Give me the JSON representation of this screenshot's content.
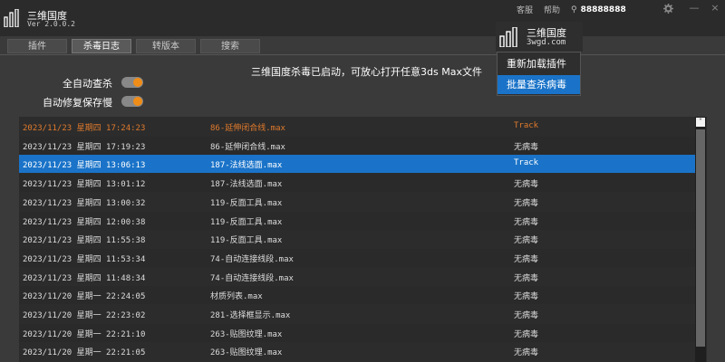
{
  "app": {
    "name": "三维国度",
    "version": "Ver 2.0.0.2"
  },
  "header": {
    "links": [
      "客服",
      "帮助"
    ],
    "username": "88888888",
    "user_icon": "user-icon",
    "settings_icon": "gear-icon",
    "minimize_label": "—",
    "close_label": "×"
  },
  "tabs": [
    {
      "label": "插件",
      "active": false
    },
    {
      "label": "杀毒日志",
      "active": true
    },
    {
      "label": "转版本",
      "active": false
    },
    {
      "label": "搜索",
      "active": false
    }
  ],
  "toggles": [
    {
      "label": "全自动查杀",
      "on": true
    },
    {
      "label": "自动修复保存慢",
      "on": true
    }
  ],
  "notice": "三维国度杀毒已启动，可放心打开任意3ds Max文件",
  "popup": {
    "brand_name": "三维国度",
    "brand_url": "3wgd.com",
    "menu_items": [
      {
        "label": "重新加载插件",
        "active": false
      },
      {
        "label": "批量查杀病毒",
        "active": true
      }
    ]
  },
  "log": {
    "rows": [
      {
        "time": "2023/11/23 星期四 17:24:23",
        "file": "86-延伸闭合线.max",
        "status": "Track",
        "kind": "threat"
      },
      {
        "time": "2023/11/23 星期四 17:19:23",
        "file": "86-延伸闭合线.max",
        "status": "无病毒",
        "kind": "normal"
      },
      {
        "time": "2023/11/23 星期四 13:06:13",
        "file": "187-法线选面.max",
        "status": "Track",
        "kind": "selected"
      },
      {
        "time": "2023/11/23 星期四 13:01:12",
        "file": "187-法线选面.max",
        "status": "无病毒",
        "kind": "normal"
      },
      {
        "time": "2023/11/23 星期四 13:00:32",
        "file": "119-反面工具.max",
        "status": "无病毒",
        "kind": "normal"
      },
      {
        "time": "2023/11/23 星期四 12:00:38",
        "file": "119-反面工具.max",
        "status": "无病毒",
        "kind": "normal"
      },
      {
        "time": "2023/11/23 星期四 11:55:38",
        "file": "119-反面工具.max",
        "status": "无病毒",
        "kind": "normal"
      },
      {
        "time": "2023/11/23 星期四 11:53:34",
        "file": "74-自动连接线段.max",
        "status": "无病毒",
        "kind": "normal"
      },
      {
        "time": "2023/11/23 星期四 11:48:34",
        "file": "74-自动连接线段.max",
        "status": "无病毒",
        "kind": "normal"
      },
      {
        "time": "2023/11/20 星期一 22:24:05",
        "file": "材质列表.max",
        "status": "无病毒",
        "kind": "normal"
      },
      {
        "time": "2023/11/20 星期一 22:23:02",
        "file": "281-选择框显示.max",
        "status": "无病毒",
        "kind": "normal"
      },
      {
        "time": "2023/11/20 星期一 22:21:10",
        "file": "263-贴图纹理.max",
        "status": "无病毒",
        "kind": "normal"
      },
      {
        "time": "2023/11/20 星期一 22:21:05",
        "file": "263-贴图纹理.max",
        "status": "无病毒",
        "kind": "normal"
      }
    ]
  },
  "scrollbar": {
    "up_glyph": "˄"
  }
}
